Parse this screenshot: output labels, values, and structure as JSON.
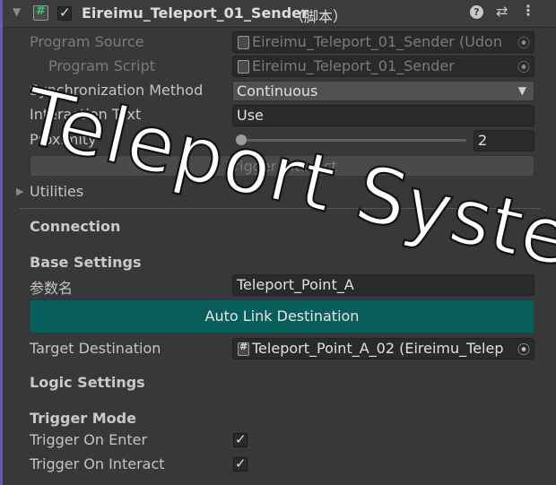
{
  "header": {
    "title": "Eireimu_Teleport_01_Sender",
    "subtitle": "（脚本）"
  },
  "program_source": {
    "label": "Program Source",
    "value": "Eireimu_Teleport_01_Sender (Udon"
  },
  "program_script": {
    "label": "Program Script",
    "value": "Eireimu_Teleport_01_Sender"
  },
  "sync_method": {
    "label": "Synchronization Method",
    "value": "Continuous"
  },
  "interaction_text": {
    "label": "Interaction Text",
    "value": "Use"
  },
  "proximity": {
    "label": "Proximity",
    "value": "2",
    "slider_fraction": 0.0
  },
  "trigger_interact_button": "Trigger Interact",
  "utilities": {
    "label": "Utilities"
  },
  "sections": {
    "connection": "Connection",
    "base_settings": "Base Settings",
    "logic_settings": "Logic Settings",
    "trigger_mode": "Trigger Mode"
  },
  "param_name": {
    "label": "参数名",
    "value": "Teleport_Point_A"
  },
  "auto_link_button": "Auto Link Destination",
  "target_destination": {
    "label": "Target Destination",
    "value": "Teleport_Point_A_02 (Eireimu_Telep"
  },
  "trigger_on_enter": {
    "label": "Trigger On Enter",
    "checked": true
  },
  "trigger_on_interact": {
    "label": "Trigger On Interact",
    "checked": true
  },
  "watermark": "Teleport System",
  "colors": {
    "accent_button": "#075e5b",
    "window_bg": "#383838",
    "field_bg": "#2a2a2a"
  }
}
